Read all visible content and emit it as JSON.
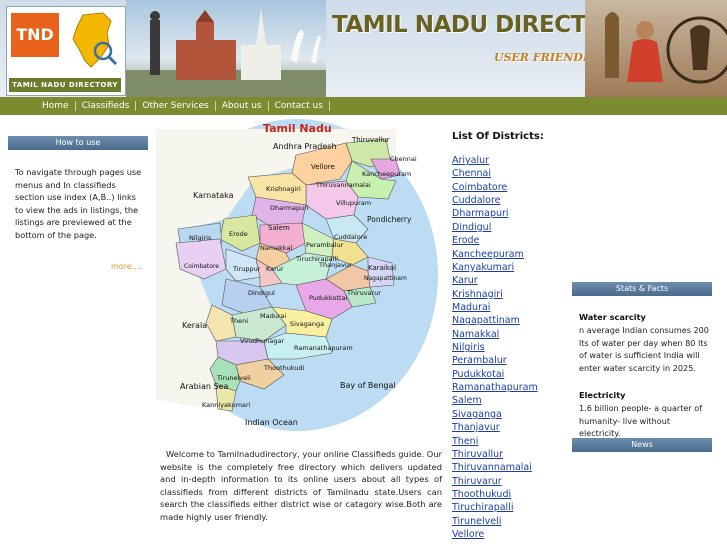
{
  "header": {
    "logo_text": "TND",
    "logo_caption": "TAMIL NADU DIRECTORY",
    "title": "TAMIL NADU DIRECTORY",
    "subtitle": "USER FRIENDLY"
  },
  "nav": {
    "items": [
      "Home",
      "Classifieds",
      "Other Services",
      "About us",
      "Contact us"
    ]
  },
  "howto": {
    "header": "How to use",
    "text": "To navigate through pages use menus and In classifieds section use index (A,B..) links to view the ads in listings, the listings are previewed at the bottom of the page.",
    "more": "more...."
  },
  "map": {
    "title": "Tamil Nadu",
    "labels": {
      "andhra": "Andhra Pradesh",
      "karnataka": "Karnataka",
      "kerala": "Kerala",
      "pondicherry": "Pondicherry",
      "karaikal": "Karaikal",
      "arabian": "Arabian Sea",
      "bengal": "Bay of Bengal",
      "indian": "Indian Ocean",
      "thiruvallur": "Thiruvallur",
      "chennai": "Chennai",
      "vellore": "Vellore",
      "kancheepuram": "Kancheepuram",
      "thiruvannamalai": "Thiruvannamalai",
      "krishnagiri": "Krishnagiri",
      "dharmapuri": "Dharmapuri",
      "villupuram": "Villupuram",
      "salem": "Salem",
      "erode": "Erode",
      "nilgiris": "Nilgiris",
      "namakkal": "Namakkal",
      "perambalur": "Perambalur",
      "cuddalore": "Cuddalore",
      "coimbatore": "Coimbatore",
      "tiruppur": "Tiruppur",
      "karur": "Karur",
      "tiruchirapalli": "Tiruchirapalli",
      "thanjavur": "Thanjavur",
      "nagapattinam": "Nagapattinam",
      "thiruvarur": "Thiruvarur",
      "dindigul": "Dindigul",
      "pudukkottai": "Pudukkottai",
      "theni": "Theni",
      "madurai": "Madurai",
      "sivaganga": "Sivaganga",
      "virudhunagar": "Virudhunagar",
      "ramanathapuram": "Ramanathapuram",
      "thoothukudi": "Thoothukudi",
      "tirunelveli": "Tirunelveli",
      "kanniyakumari": "Kanniyakumari"
    }
  },
  "welcome": "Welcome to Tamilnadudirectory, your online Classifieds guide. Our website is the completely free directory which delivers updated and in-depth information to its online users about all types of classifieds from different districts of Tamilnadu state.Users can search the classifieds either district wise or catagory wise.Both are made highly user friendly.",
  "districts": {
    "title": "List Of Districts:",
    "items": [
      "Ariyalur",
      "Chennai",
      "Coimbatore",
      "Cuddalore",
      "Dharmapuri",
      "Dindigul",
      "Erode",
      "Kancheepuram",
      "Kanyakumari",
      "Karur",
      "Krishnagiri",
      "Madurai",
      "Nagapattinam",
      "Namakkal",
      "Nilgiris",
      "Perambalur",
      "Pudukkotai",
      "Ramanathapuram",
      "Salem",
      "Sivaganga",
      "Thanjavur",
      "Theni",
      "Thiruvallur",
      "Thiruvannamalai",
      "Thiruvarur",
      "Thoothukudi",
      "Tiruchirapalli",
      "Tirunelveli",
      "Vellore"
    ]
  },
  "stats": {
    "header": "Stats & Facts",
    "fact1_title": "Water scarcity",
    "fact1_text": "n average Indian consumes 200 lts of water per day when 80 lts of water is sufficient India will enter water scarcity in 2025.",
    "fact2_title": "Electricity",
    "fact2_text": "1.6 billion people- a quarter of humanity- live without electricity."
  },
  "news": {
    "header": "News"
  },
  "colors": {
    "nav": "#7b8b2f",
    "panel_header": "#5a7b9c",
    "link": "#1b3fa8",
    "logo_orange": "#e8621a"
  }
}
